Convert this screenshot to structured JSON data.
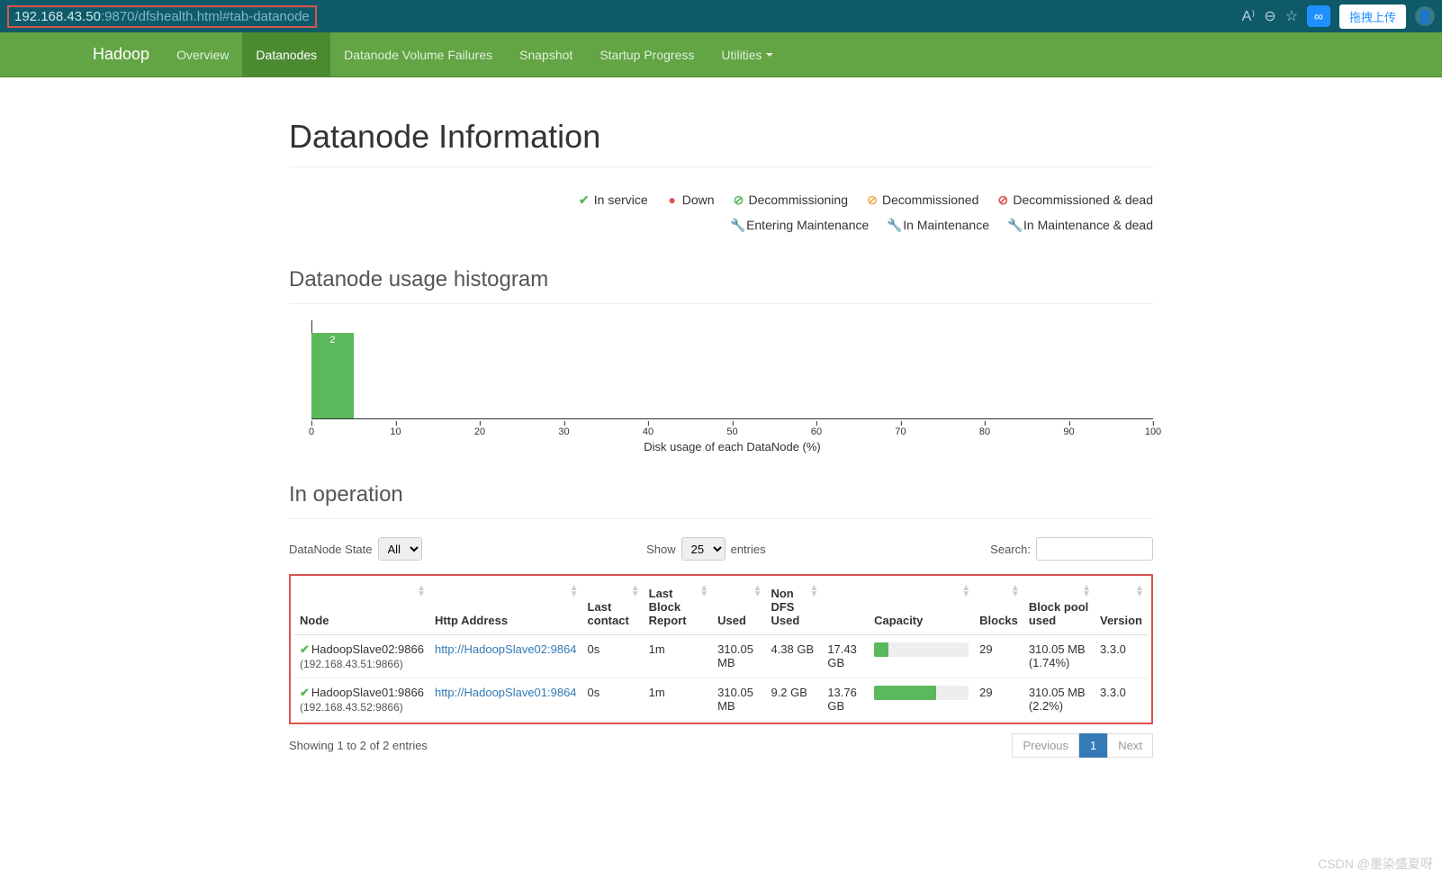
{
  "browser": {
    "url_host": "192.168.43.50",
    "url_rest": ":9870/dfshealth.html#tab-datanode",
    "upload_label": "拖拽上传"
  },
  "nav": {
    "brand": "Hadoop",
    "items": [
      "Overview",
      "Datanodes",
      "Datanode Volume Failures",
      "Snapshot",
      "Startup Progress",
      "Utilities"
    ],
    "active_index": 1
  },
  "page": {
    "title": "Datanode Information",
    "section_histogram": "Datanode usage histogram",
    "section_operation": "In operation"
  },
  "legend": [
    {
      "icon": "✔",
      "cls": "ic-check",
      "label": "In service"
    },
    {
      "icon": "●",
      "cls": "ic-down",
      "label": "Down"
    },
    {
      "icon": "⊘",
      "cls": "ic-decomm",
      "label": "Decommissioning"
    },
    {
      "icon": "⊘",
      "cls": "ic-decommed",
      "label": "Decommissioned"
    },
    {
      "icon": "⊘",
      "cls": "ic-dead",
      "label": "Decommissioned & dead"
    },
    {
      "icon": "🔧",
      "cls": "ic-maint",
      "label": "Entering Maintenance"
    },
    {
      "icon": "🔧",
      "cls": "ic-maint",
      "label": "In Maintenance"
    },
    {
      "icon": "🔧",
      "cls": "ic-dead",
      "label": "In Maintenance & dead"
    }
  ],
  "chart_data": {
    "type": "bar",
    "title": "",
    "xlabel": "Disk usage of each DataNode (%)",
    "ylabel": "",
    "xlim": [
      0,
      100
    ],
    "ticks": [
      0,
      10,
      20,
      30,
      40,
      50,
      60,
      70,
      80,
      90,
      100
    ],
    "bars": [
      {
        "bin_start": 0,
        "bin_end": 5,
        "count": 2
      }
    ]
  },
  "controls": {
    "state_label": "DataNode State",
    "state_value": "All",
    "show_label": "Show",
    "show_value": "25",
    "entries_label": "entries",
    "search_label": "Search:"
  },
  "table": {
    "columns": [
      "Node",
      "Http Address",
      "Last contact",
      "Last Block Report",
      "Used",
      "Non DFS Used",
      "",
      "Capacity",
      "Blocks",
      "Block pool used",
      "Version"
    ],
    "rows": [
      {
        "node_name": "HadoopSlave02:9866",
        "node_sub": "(192.168.43.51:9866)",
        "http": "http://HadoopSlave02:9864",
        "last_contact": "0s",
        "last_block_report": "1m",
        "used": "310.05 MB",
        "non_dfs": "4.38 GB",
        "total": "17.43 GB",
        "capacity_pct": 15,
        "blocks": "29",
        "pool_used": "310.05 MB (1.74%)",
        "version": "3.3.0"
      },
      {
        "node_name": "HadoopSlave01:9866",
        "node_sub": "(192.168.43.52:9866)",
        "http": "http://HadoopSlave01:9864",
        "last_contact": "0s",
        "last_block_report": "1m",
        "used": "310.05 MB",
        "non_dfs": "9.2 GB",
        "total": "13.76 GB",
        "capacity_pct": 66,
        "blocks": "29",
        "pool_used": "310.05 MB (2.2%)",
        "version": "3.3.0"
      }
    ]
  },
  "footer": {
    "info": "Showing 1 to 2 of 2 entries",
    "prev": "Previous",
    "page": "1",
    "next": "Next"
  },
  "watermark": "CSDN @墨染盛夏呀"
}
